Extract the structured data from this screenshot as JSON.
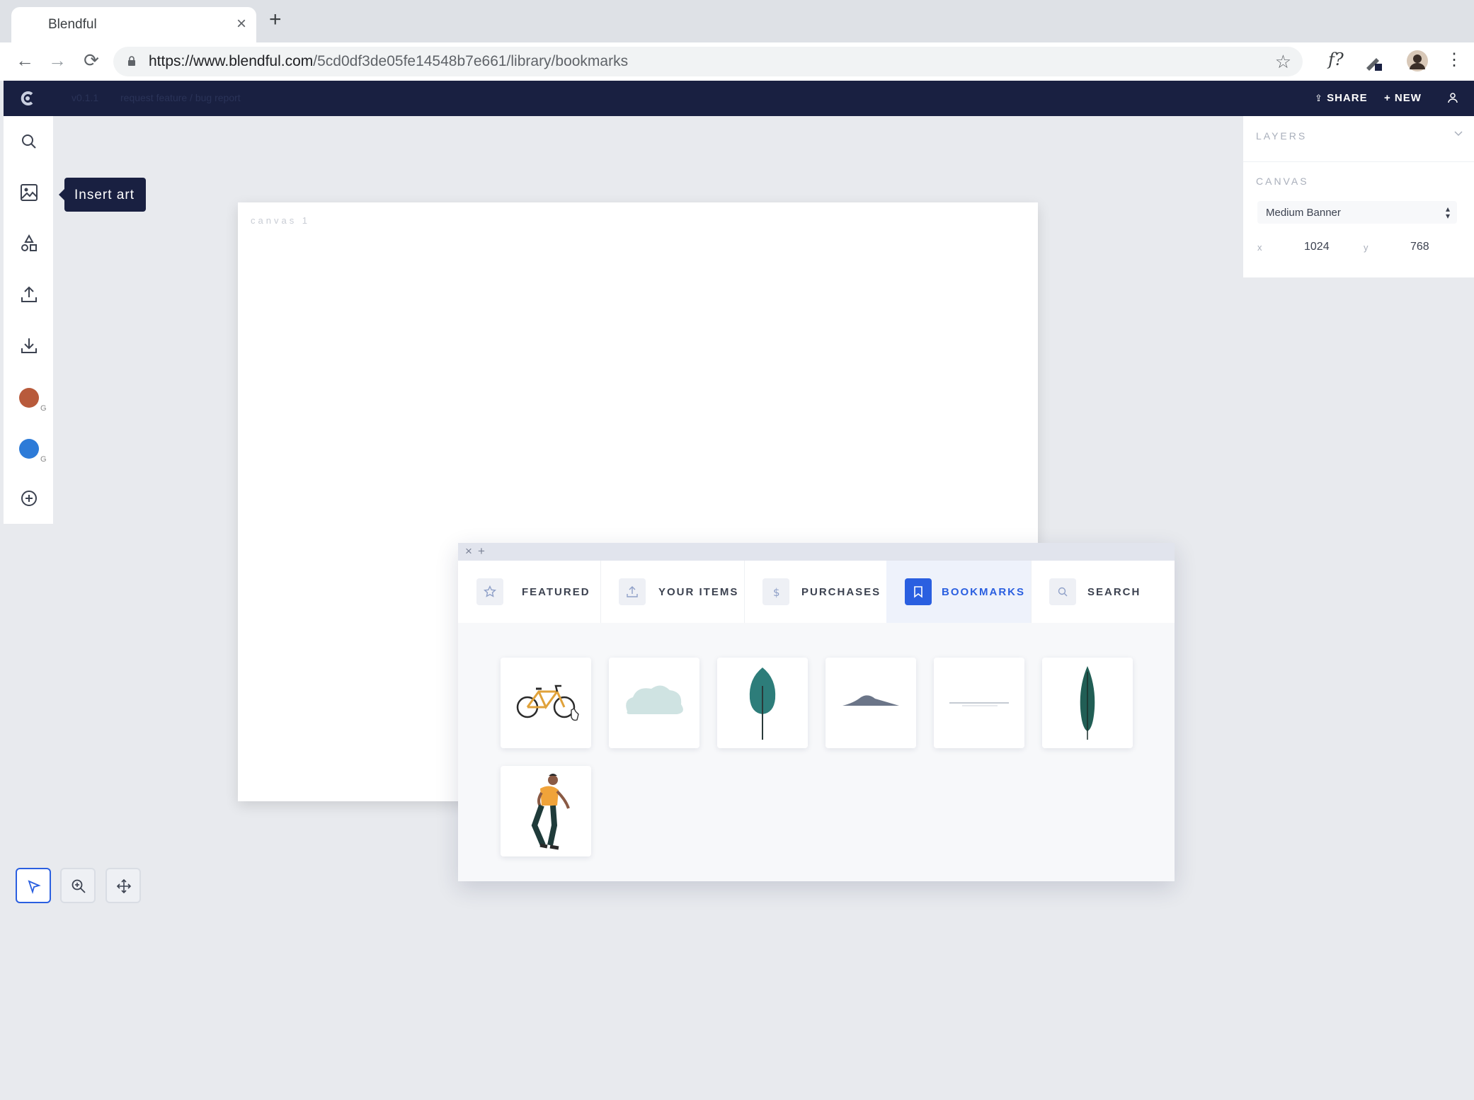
{
  "browser": {
    "tab_title": "Blendful",
    "tab_close": "×",
    "new_tab": "+",
    "url_host": "https://www.blendful.com",
    "url_path": "/5cd0df3de05fe14548b7e661/library/bookmarks",
    "back": "←",
    "forward": "→",
    "reload": "⟳",
    "ext_fx": "f?"
  },
  "appbar": {
    "version": "v0.1.1",
    "feature_link": "request feature / bug report",
    "share_label": "SHARE",
    "new_label": "+ NEW",
    "share_icon": "⇪",
    "user_icon": "user-icon"
  },
  "sidebar": {
    "tooltip": "Insert art",
    "color1": {
      "hex": "#b85a3b",
      "label": "G"
    },
    "color2": {
      "hex": "#2d7bd8",
      "label": "G"
    }
  },
  "canvas": {
    "label": "canvas 1"
  },
  "right_panel": {
    "layers_title": "LAYERS",
    "canvas_title": "CANVAS",
    "preset": "Medium Banner",
    "x_label": "x",
    "x_value": "1024",
    "y_label": "y",
    "y_value": "768"
  },
  "library": {
    "close": "×",
    "add": "+",
    "tabs": [
      {
        "label": "FEATURED",
        "icon": "star-icon"
      },
      {
        "label": "YOUR ITEMS",
        "icon": "upload-icon"
      },
      {
        "label": "PURCHASES",
        "icon": "dollar-icon"
      },
      {
        "label": "BOOKMARKS",
        "icon": "bookmark-icon",
        "active": true
      },
      {
        "label": "SEARCH",
        "icon": "search-icon"
      }
    ],
    "items": [
      "bicycle",
      "bush",
      "round-tree",
      "hill",
      "water-ripple",
      "tall-leaf",
      "walking-man"
    ]
  },
  "tools": {
    "select": "select-tool",
    "zoom": "zoom-tool",
    "pan": "pan-tool"
  }
}
